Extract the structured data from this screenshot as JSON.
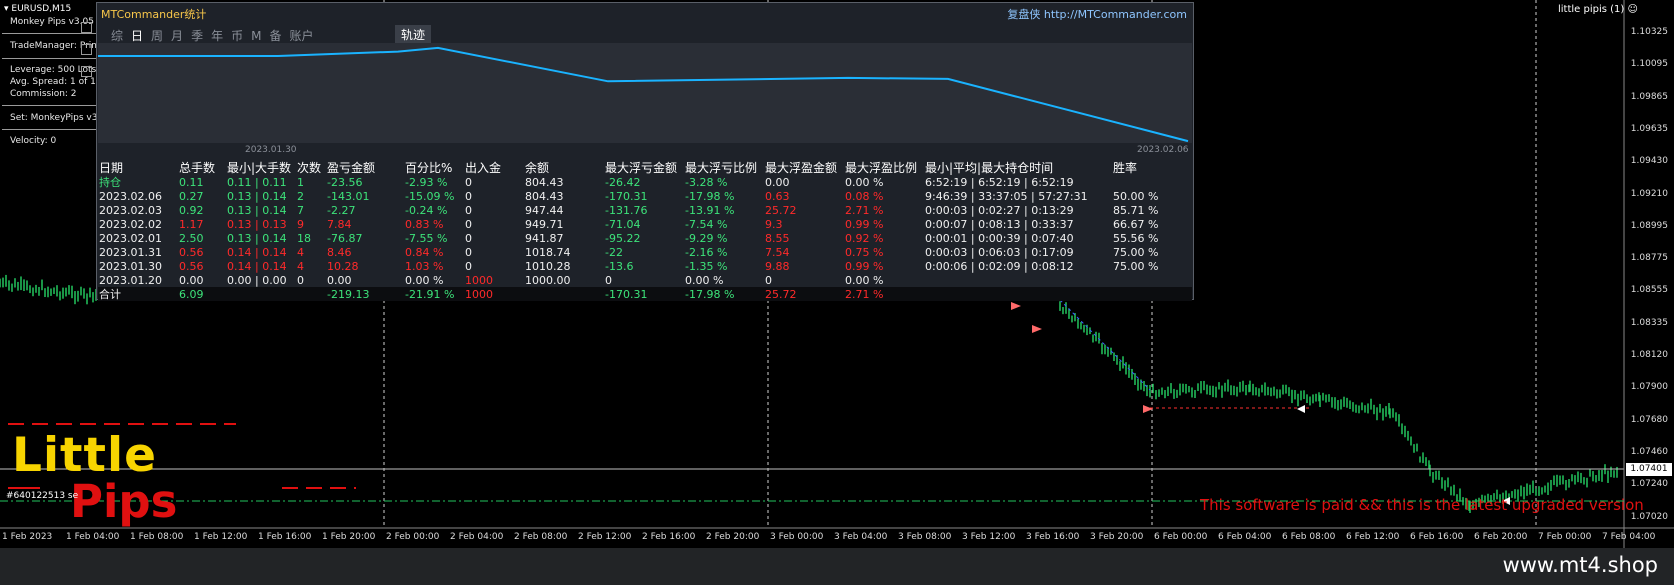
{
  "window": {
    "symbol": "EURUSD,M15",
    "indicator_name": "little pipis (1)",
    "smiley": "☺"
  },
  "info_panel": {
    "ea_name": "Monkey Pips v3.05",
    "trade_manager": "TradeManager: Primary",
    "leverage": "Leverage: 500 Lots: 0.11,",
    "avg_spread": "Avg. Spread: 1 of 18,",
    "commission": "Commission: 2",
    "set": "Set: MonkeyPips v3.05",
    "velocity": "Velocity: 0"
  },
  "mtc_panel": {
    "title": "MTCommander统计",
    "brand": "复盘侠",
    "link": "http://MTCommander.com",
    "tabs": [
      "综",
      "日",
      "周",
      "月",
      "季",
      "年",
      "币",
      "M",
      "备",
      "账户"
    ],
    "active_tab": "日",
    "track_button": "轨迹",
    "eq_start_date": "2023.01.30",
    "eq_end_date": "2023.02.06",
    "columns": [
      "日期",
      "总手数",
      "最小|大手数",
      "次数",
      "盈亏金额",
      "百分比%",
      "出入金",
      "余额",
      "最大浮亏金额",
      "最大浮亏比例",
      "最大浮盈金额",
      "最大浮盈比例",
      "最小|平均|最大持仓时间",
      "胜率"
    ],
    "rows": [
      [
        "持仓",
        "0.11",
        "0.11 | 0.11",
        "1",
        "-23.56",
        "-2.93 %",
        "0",
        "804.43",
        "-26.42",
        "-3.28 %",
        "0.00",
        "0.00 %",
        "6:52:19 | 6:52:19 | 6:52:19",
        ""
      ],
      [
        "2023.02.06",
        "0.27",
        "0.13 | 0.14",
        "2",
        "-143.01",
        "-15.09 %",
        "0",
        "804.43",
        "-170.31",
        "-17.98 %",
        "0.63",
        "0.08 %",
        "9:46:39 | 33:37:05 | 57:27:31",
        "50.00 %"
      ],
      [
        "2023.02.03",
        "0.92",
        "0.13 | 0.14",
        "7",
        "-2.27",
        "-0.24 %",
        "0",
        "947.44",
        "-131.76",
        "-13.91 %",
        "25.72",
        "2.71 %",
        "0:00:03 | 0:02:27 | 0:13:29",
        "85.71 %"
      ],
      [
        "2023.02.02",
        "1.17",
        "0.13 | 0.13",
        "9",
        "7.84",
        "0.83 %",
        "0",
        "949.71",
        "-71.04",
        "-7.54 %",
        "9.3",
        "0.99 %",
        "0:00:07 | 0:08:13 | 0:33:37",
        "66.67 %"
      ],
      [
        "2023.02.01",
        "2.50",
        "0.13 | 0.14",
        "18",
        "-76.87",
        "-7.55 %",
        "0",
        "941.87",
        "-95.22",
        "-9.29 %",
        "8.55",
        "0.92 %",
        "0:00:01 | 0:00:39 | 0:07:40",
        "55.56 %"
      ],
      [
        "2023.01.31",
        "0.56",
        "0.14 | 0.14",
        "4",
        "8.46",
        "0.84 %",
        "0",
        "1018.74",
        "-22",
        "-2.16 %",
        "7.54",
        "0.75 %",
        "0:00:03 | 0:06:03 | 0:17:09",
        "75.00 %"
      ],
      [
        "2023.01.30",
        "0.56",
        "0.14 | 0.14",
        "4",
        "10.28",
        "1.03 %",
        "0",
        "1010.28",
        "-13.6",
        "-1.35 %",
        "9.88",
        "0.99 %",
        "0:00:06 | 0:02:09 | 0:08:12",
        "75.00 %"
      ],
      [
        "2023.01.20",
        "0.00",
        "0.00 | 0.00",
        "0",
        "0.00",
        "0.00 %",
        "1000",
        "1000.00",
        "0",
        "0.00 %",
        "0",
        "0.00 %",
        "",
        ""
      ]
    ],
    "row_colors": [
      "g",
      "g",
      "g",
      "r",
      "g",
      "r",
      "r",
      "w"
    ],
    "total": [
      "合计",
      "6.09",
      "",
      "",
      "-219.13",
      "-21.91 %",
      "1000",
      "",
      "-170.31",
      "-17.98 %",
      "25.72",
      "2.71 %",
      "",
      ""
    ],
    "equity_curve": [
      1000,
      1000,
      1000,
      1010.28,
      1018.74,
      941.87,
      949.71,
      947.44,
      804.43
    ]
  },
  "price_axis": {
    "ticks": [
      "1.10325",
      "1.10095",
      "1.09865",
      "1.09635",
      "1.09430",
      "1.09210",
      "1.08995",
      "1.08775",
      "1.08555",
      "1.08335",
      "1.08120",
      "1.07900",
      "1.07680",
      "1.07460",
      "1.07240",
      "1.07020"
    ],
    "current_price": "1.07401"
  },
  "time_axis": {
    "ticks": [
      "1 Feb 2023",
      "1 Feb 04:00",
      "1 Feb 08:00",
      "1 Feb 12:00",
      "1 Feb 16:00",
      "1 Feb 20:00",
      "2 Feb 00:00",
      "2 Feb 04:00",
      "2 Feb 08:00",
      "2 Feb 12:00",
      "2 Feb 16:00",
      "2 Feb 20:00",
      "3 Feb 00:00",
      "3 Feb 04:00",
      "3 Feb 08:00",
      "3 Feb 12:00",
      "3 Feb 16:00",
      "3 Feb 20:00",
      "6 Feb 00:00",
      "6 Feb 04:00",
      "6 Feb 08:00",
      "6 Feb 12:00",
      "6 Feb 16:00",
      "6 Feb 20:00",
      "7 Feb 00:00",
      "7 Feb 04:00"
    ]
  },
  "overlay": {
    "logo_top": "Little",
    "logo_bottom": "Pips",
    "order_label": "#640122513 se",
    "paid_notice": "This software is paid && this is the latest upgraded version",
    "watermark": "www.mt4.shop"
  },
  "colors": {
    "bull": "#22c55e",
    "equity_line": "#1ab3ff",
    "accent_yellow": "#f7d400",
    "accent_red": "#e01010"
  }
}
